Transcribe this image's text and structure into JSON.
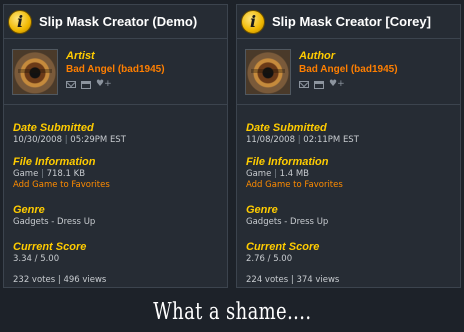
{
  "panels": [
    {
      "title": "Slip Mask Creator (Demo)",
      "role": "Artist",
      "username": "Bad Angel (bad1945)",
      "date_heading": "Date Submitted",
      "date": "10/30/2008",
      "time": "05:29PM EST",
      "file_heading": "File Information",
      "file_type": "Game",
      "file_size": "718.1 KB",
      "favorites_link": "Add Game to Favorites",
      "genre_heading": "Genre",
      "genre": "Gadgets - Dress Up",
      "score_heading": "Current Score",
      "score": "3.34 / 5.00",
      "votes": "232 votes",
      "views": "496 views"
    },
    {
      "title": "Slip Mask Creator [Corey]",
      "role": "Author",
      "username": "Bad Angel (bad1945)",
      "date_heading": "Date Submitted",
      "date": "11/08/2008",
      "time": "02:11PM EST",
      "file_heading": "File Information",
      "file_type": "Game",
      "file_size": "1.4 MB",
      "favorites_link": "Add Game to Favorites",
      "genre_heading": "Genre",
      "genre": "Gadgets - Dress Up",
      "score_heading": "Current Score",
      "score": "2.76 / 5.00",
      "votes": "224 votes",
      "views": "374 views"
    }
  ],
  "separator": "|",
  "caption": "What a shame....",
  "icons": {
    "title": "info-icon",
    "user_actions": [
      "mail-icon",
      "window-icon",
      "heart-plus-icon"
    ]
  },
  "colors": {
    "heading": "#ffcc00",
    "username": "#ff7f00",
    "link": "#ff8c00",
    "background": "#1d2229",
    "panel": "#262c34"
  }
}
